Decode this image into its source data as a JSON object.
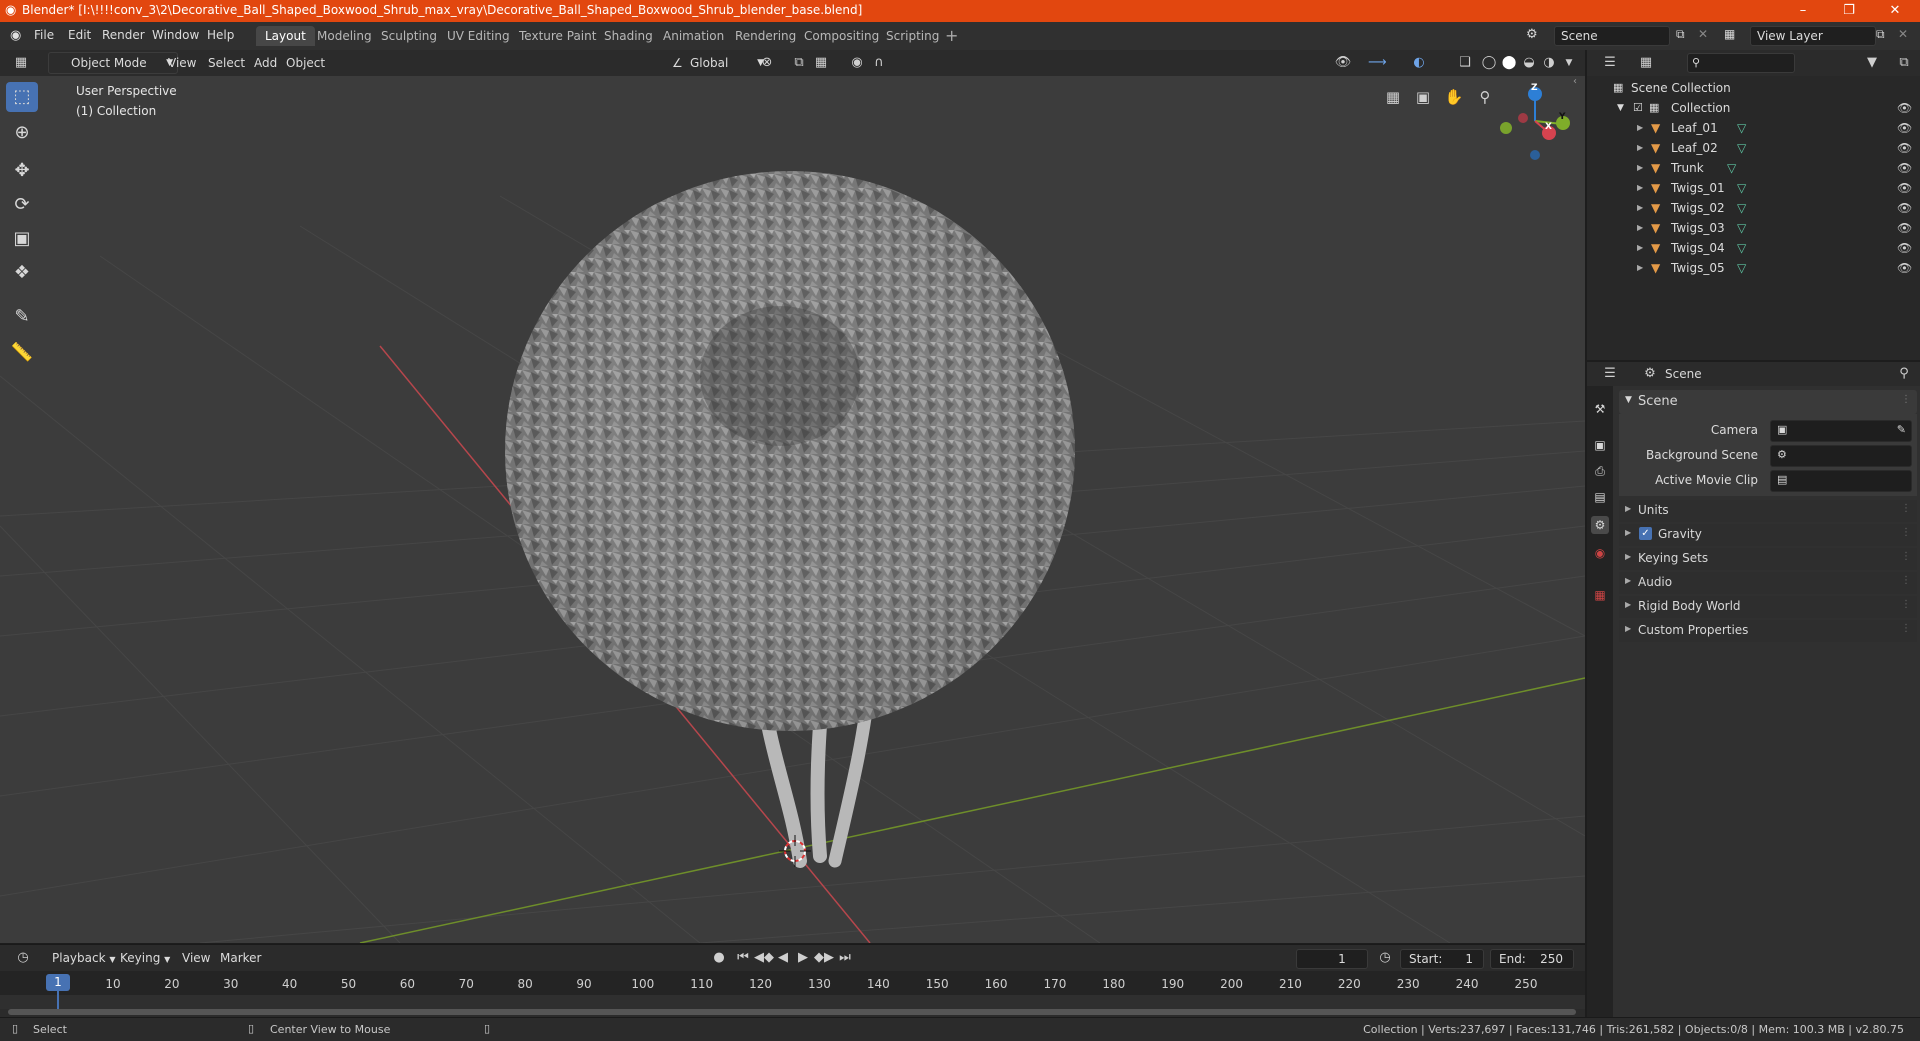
{
  "window": {
    "title": "Blender* [I:\\!!!!conv_3\\2\\Decorative_Ball_Shaped_Boxwood_Shrub_max_vray\\Decorative_Ball_Shaped_Boxwood_Shrub_blender_base.blend]",
    "accent_color": "#e2470f"
  },
  "menu": [
    "File",
    "Edit",
    "Render",
    "Window",
    "Help"
  ],
  "workspaces": {
    "active": "Layout",
    "tabs": [
      "Layout",
      "Modeling",
      "Sculpting",
      "UV Editing",
      "Texture Paint",
      "Shading",
      "Animation",
      "Rendering",
      "Compositing",
      "Scripting"
    ]
  },
  "scene_selector": "Scene",
  "view_layer": "View Layer",
  "viewport_header": {
    "mode": "Object Mode",
    "menus": [
      "View",
      "Select",
      "Add",
      "Object"
    ],
    "transform_orientation": "Global"
  },
  "viewport": {
    "perspective": "User Perspective",
    "collection": "(1) Collection",
    "gizmo_axes": {
      "x": "X",
      "y": "Y",
      "z": "Z"
    },
    "axis_colors": {
      "x": "#d6434f",
      "y": "#7fad2a",
      "z": "#2d7fd6"
    }
  },
  "outliner": {
    "root": "Scene Collection",
    "collection": "Collection",
    "objects": [
      "Leaf_01",
      "Leaf_02",
      "Trunk",
      "Twigs_01",
      "Twigs_02",
      "Twigs_03",
      "Twigs_04",
      "Twigs_05"
    ]
  },
  "properties": {
    "context": "Scene",
    "panel_title": "Scene",
    "fields": {
      "camera": "Camera",
      "background_scene": "Background Scene",
      "active_movie_clip": "Active Movie Clip"
    },
    "subpanels": [
      "Units",
      "Gravity",
      "Keying Sets",
      "Audio",
      "Rigid Body World",
      "Custom Properties"
    ],
    "gravity_checked": true
  },
  "timeline": {
    "menus": [
      "Playback",
      "Keying",
      "View",
      "Marker"
    ],
    "current_frame": "1",
    "start_label": "Start:",
    "start": "1",
    "end_label": "End:",
    "end": "250",
    "ticks": [
      "1",
      "10",
      "20",
      "30",
      "40",
      "50",
      "60",
      "70",
      "80",
      "90",
      "100",
      "110",
      "120",
      "130",
      "140",
      "150",
      "160",
      "170",
      "180",
      "190",
      "200",
      "210",
      "220",
      "230",
      "240",
      "250"
    ]
  },
  "statusbar": {
    "left_hint": "Select",
    "mid_hint": "Center View to Mouse",
    "stats": "Collection | Verts:237,697 | Faces:131,746 | Tris:261,582 | Objects:0/8 | Mem: 100.3 MB | v2.80.75"
  }
}
